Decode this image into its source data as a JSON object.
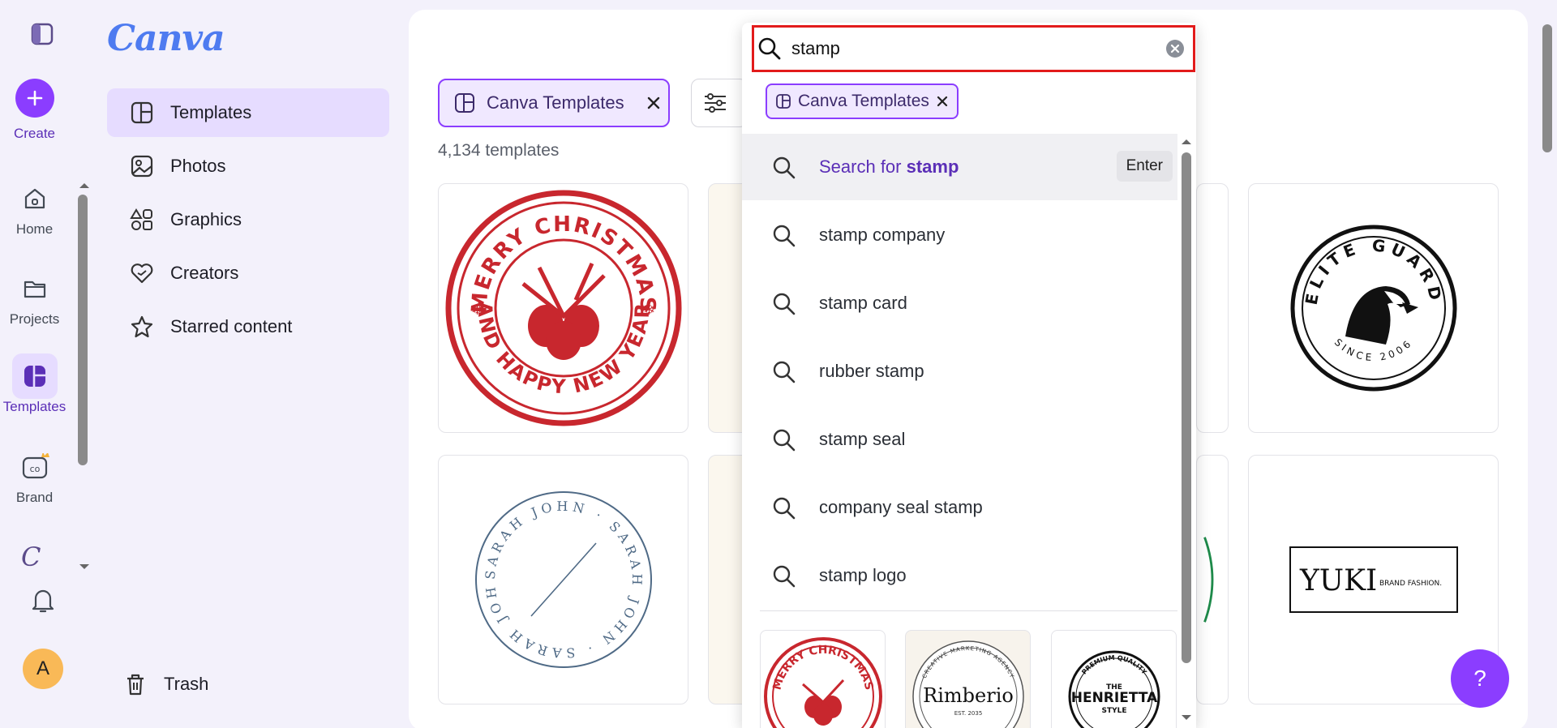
{
  "app": {
    "logo_text": "Canva"
  },
  "rail": {
    "create_label": "Create",
    "home_label": "Home",
    "projects_label": "Projects",
    "templates_label": "Templates",
    "brand_label": "Brand",
    "avatar_initial": "A"
  },
  "nav": {
    "items": [
      {
        "label": "Templates",
        "icon": "templates-icon",
        "active": true
      },
      {
        "label": "Photos",
        "icon": "photos-icon"
      },
      {
        "label": "Graphics",
        "icon": "graphics-icon"
      },
      {
        "label": "Creators",
        "icon": "creators-icon"
      },
      {
        "label": "Starred content",
        "icon": "star-icon"
      }
    ],
    "trash_label": "Trash"
  },
  "main": {
    "filter_chip_label": "Canva Templates",
    "count_text": "4,134 templates",
    "cards": [
      {
        "text": "MERRY CHRISTMAS AND HAPPY NEW YEAR"
      },
      {
        "text": "ELITE GUARD SINCE 2006"
      },
      {
        "text": "SARAH JOHN"
      },
      {
        "text": "YUKI BRAND FASHION."
      }
    ]
  },
  "search": {
    "value": "stamp",
    "chip_label": "Canva Templates",
    "search_for_prefix": "Search for ",
    "search_for_term": "stamp",
    "enter_key": "Enter",
    "suggestions": [
      "stamp company",
      "stamp card",
      "rubber stamp",
      "stamp seal",
      "company seal stamp",
      "stamp logo"
    ],
    "thumbs": [
      {
        "text": "MERRY CHRISTMAS"
      },
      {
        "text": "Rimberio",
        "sub": "CREATIVE MARKETING AGENCY",
        "est": "EST. 2035"
      },
      {
        "text": "HENRIETTA",
        "sub": "PREMIUM QUALITY",
        "small": "THE",
        "style": "STYLE"
      }
    ]
  },
  "help": {
    "label": "?"
  },
  "colors": {
    "accent": "#8b3dff",
    "highlight_red": "#e21b1b",
    "stamp_red": "#c8272e"
  }
}
